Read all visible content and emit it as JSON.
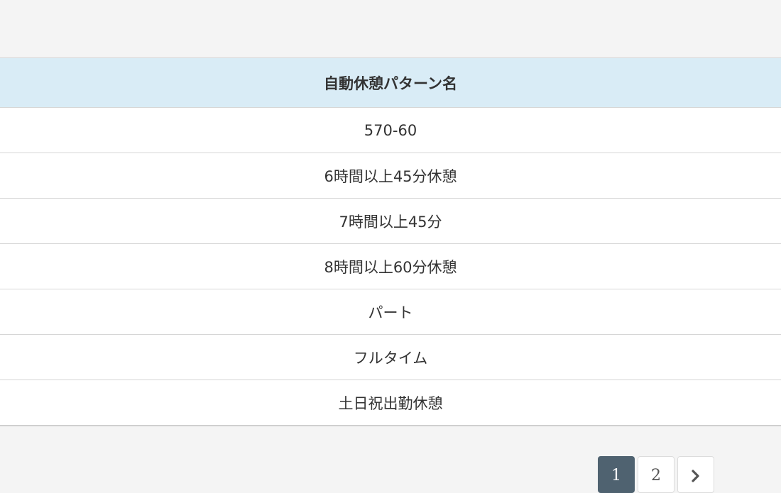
{
  "table": {
    "header": "自動休憩パターン名",
    "rows": [
      "570-60",
      "6時間以上45分休憩",
      "7時間以上45分",
      "8時間以上60分休憩",
      "パート",
      "フルタイム",
      "土日祝出勤休憩"
    ]
  },
  "pagination": {
    "pages": [
      "1",
      "2"
    ],
    "current_page": "1",
    "next_icon": "chevron-right-icon",
    "active_color": "#4f6270"
  },
  "colors": {
    "header_bg": "#d9ecf6",
    "page_bg": "#f4f4f4"
  }
}
